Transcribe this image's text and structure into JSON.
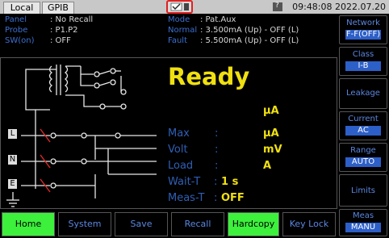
{
  "topbar": {
    "tab1": "Local",
    "tab2": "GPIB",
    "clock": "09:48:08 2022.07.20"
  },
  "info": {
    "left": [
      {
        "label": "Panel",
        "value": ": No Recall"
      },
      {
        "label": "Probe",
        "value": ":  P1.P2"
      },
      {
        "label": "SW(on)",
        "value": ":  OFF"
      }
    ],
    "right": [
      {
        "label": "Mode",
        "value": ": Pat.Aux"
      },
      {
        "label": "Normal",
        "value": ": 3.500mA (Up) - OFF (L)"
      },
      {
        "label": "Fault",
        "value": ": 5.500mA (Up) - OFF (L)"
      }
    ]
  },
  "side": {
    "network": {
      "title": "Network",
      "value": "F-F(OFF)"
    },
    "class": {
      "title": "Class",
      "value": "I-B"
    },
    "leakage": "Leakage",
    "current": {
      "title": "Current",
      "value": "AC"
    },
    "range": {
      "title": "Range",
      "value": "AUTO"
    },
    "limits": "Limits",
    "meas": {
      "title": "Meas",
      "value": "MANU"
    }
  },
  "main": {
    "status": "Ready",
    "unit_top": "µA",
    "rows": [
      {
        "label": "Max",
        "sep": ":",
        "value": "µA"
      },
      {
        "label": "Volt",
        "sep": ":",
        "value": "mV"
      },
      {
        "label": "Load",
        "sep": ":",
        "value": "A"
      }
    ],
    "wait_label": "Wait-T",
    "wait_sep": ":",
    "wait_value": "1 s",
    "meas_label": "Meas-T",
    "meas_sep": ":",
    "meas_value": "OFF",
    "terminals": [
      "L",
      "N",
      "E"
    ]
  },
  "bottom": [
    "Home",
    "System",
    "Save",
    "Recall",
    "Hardcopy",
    "Key Lock"
  ],
  "colors": {
    "highlight": "#3cf03c",
    "accent_blue": "#2d5fc8",
    "yellow": "#f0e010"
  }
}
